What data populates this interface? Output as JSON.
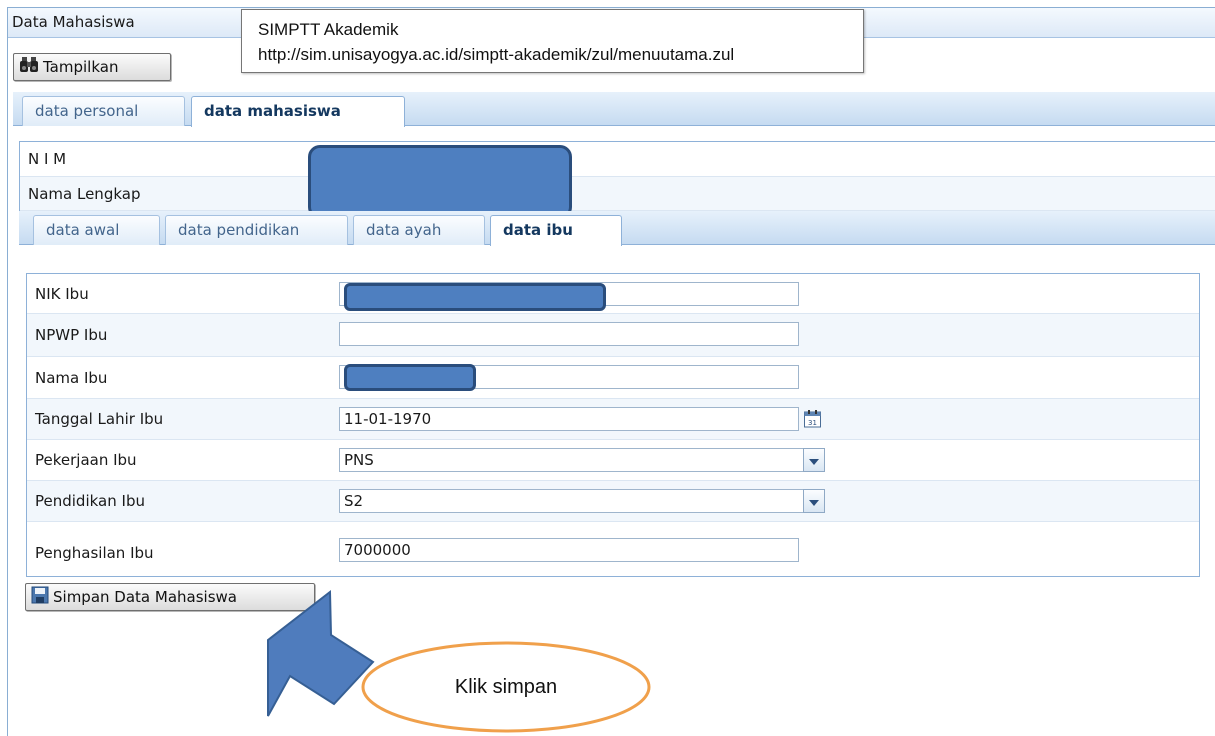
{
  "window": {
    "title": "Data Mahasiswa"
  },
  "tooltip": {
    "title": "SIMPTT Akademik",
    "url": "http://sim.unisayogya.ac.id/simptt-akademik/zul/menuutama.zul"
  },
  "toolbar": {
    "show_label": "Tampilkan"
  },
  "main_tabs": [
    {
      "label": "data personal",
      "active": false
    },
    {
      "label": "data mahasiswa",
      "active": true
    }
  ],
  "student": {
    "nim_label": "N I M",
    "name_label": "Nama Lengkap"
  },
  "sub_tabs": [
    {
      "label": "data awal",
      "active": false
    },
    {
      "label": "data pendidikan",
      "active": false
    },
    {
      "label": "data ayah",
      "active": false
    },
    {
      "label": "data ibu",
      "active": true
    }
  ],
  "form": {
    "nik": {
      "label": "NIK Ibu",
      "value": ""
    },
    "npwp": {
      "label": "NPWP Ibu",
      "value": ""
    },
    "nama": {
      "label": "Nama Ibu",
      "value": ""
    },
    "tgl_lahir": {
      "label": "Tanggal Lahir Ibu",
      "value": "11-01-1970"
    },
    "pekerjaan": {
      "label": "Pekerjaan Ibu",
      "value": "PNS"
    },
    "pendidikan": {
      "label": "Pendidikan Ibu",
      "value": "S2"
    },
    "penghasilan": {
      "label": "Penghasilan Ibu",
      "value": "7000000"
    }
  },
  "save_button": {
    "label": "Simpan Data Mahasiswa"
  },
  "annotation": {
    "callout_text": "Klik simpan",
    "arrow_color": "#4f7cbd",
    "callout_border": "#f0a04b"
  },
  "icons": [
    "binoculars-icon",
    "calendar-icon",
    "chevron-down-icon",
    "floppy-disk-icon"
  ]
}
